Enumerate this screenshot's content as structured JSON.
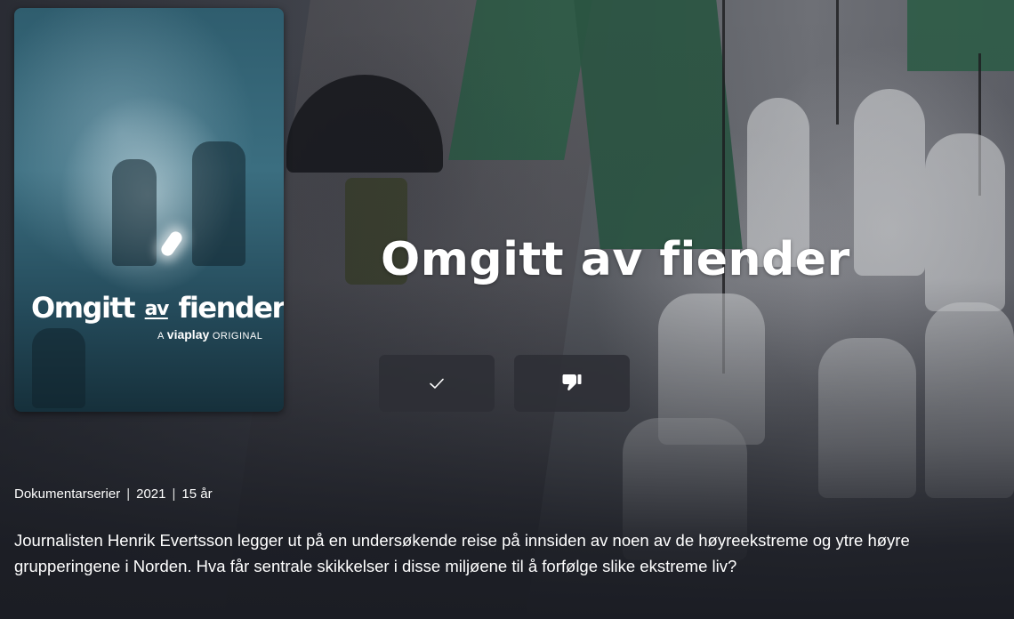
{
  "poster": {
    "title_part1": "Omgitt",
    "title_part2": "av",
    "title_part3": "fiender",
    "subtitle_prefix": "A",
    "subtitle_brand": "viaplay",
    "subtitle_suffix": "ORIGINAL"
  },
  "title": "Omgitt av fiender",
  "actions": {
    "add_icon": "checkmark-icon",
    "dislike_icon": "thumbs-down-icon"
  },
  "meta": {
    "genre": "Dokumentarserier",
    "separator": "|",
    "year": "2021",
    "age_rating": "15 år"
  },
  "description": "Journalisten Henrik Evertsson legger ut på en undersøkende reise på innsiden av noen av de høyreekstreme og ytre høyre grupperingene i Norden. Hva får sentrale skikkelser i disse miljøene til å forfølge slike ekstreme liv?",
  "colors": {
    "background": "#1b1d24",
    "button_bg": "#2d2f36",
    "flag_green": "#2e5b47"
  }
}
